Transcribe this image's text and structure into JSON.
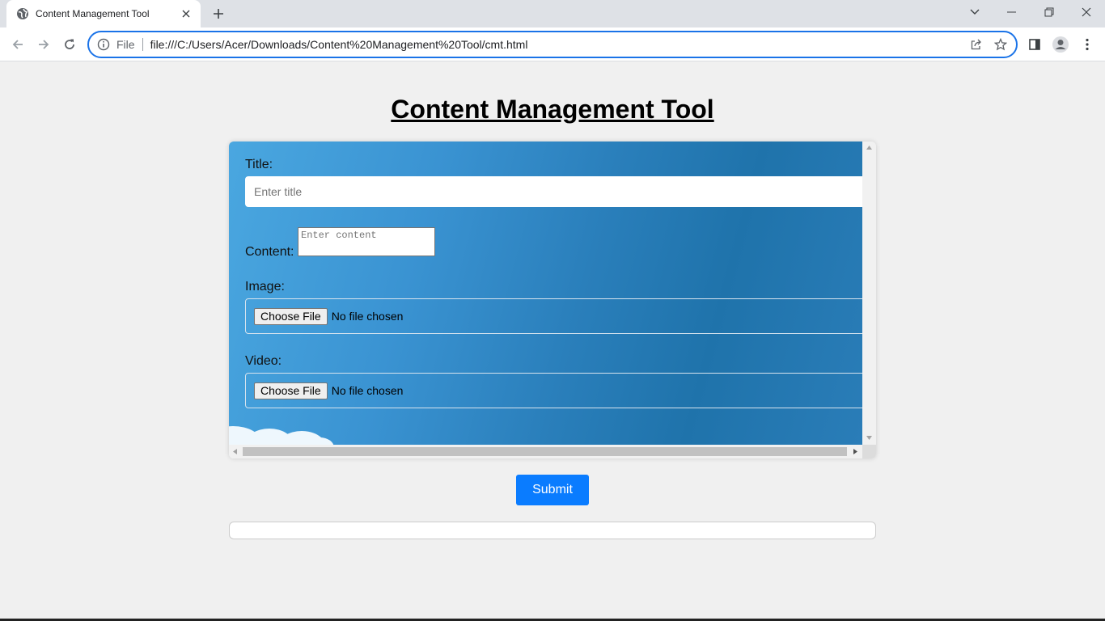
{
  "browser": {
    "tab_title": "Content Management Tool",
    "url_scheme": "File",
    "url": "file:///C:/Users/Acer/Downloads/Content%20Management%20Tool/cmt.html",
    "accent_color": "#1a73e8"
  },
  "page": {
    "heading": "Content Management Tool",
    "form": {
      "title_label": "Title:",
      "title_placeholder": "Enter title",
      "content_label": "Content:",
      "content_placeholder": "Enter content",
      "image_label": "Image:",
      "video_label": "Video:",
      "choose_file_label": "Choose File",
      "no_file_text": "No file chosen"
    },
    "submit_label": "Submit",
    "submit_color": "#0a7cff"
  }
}
